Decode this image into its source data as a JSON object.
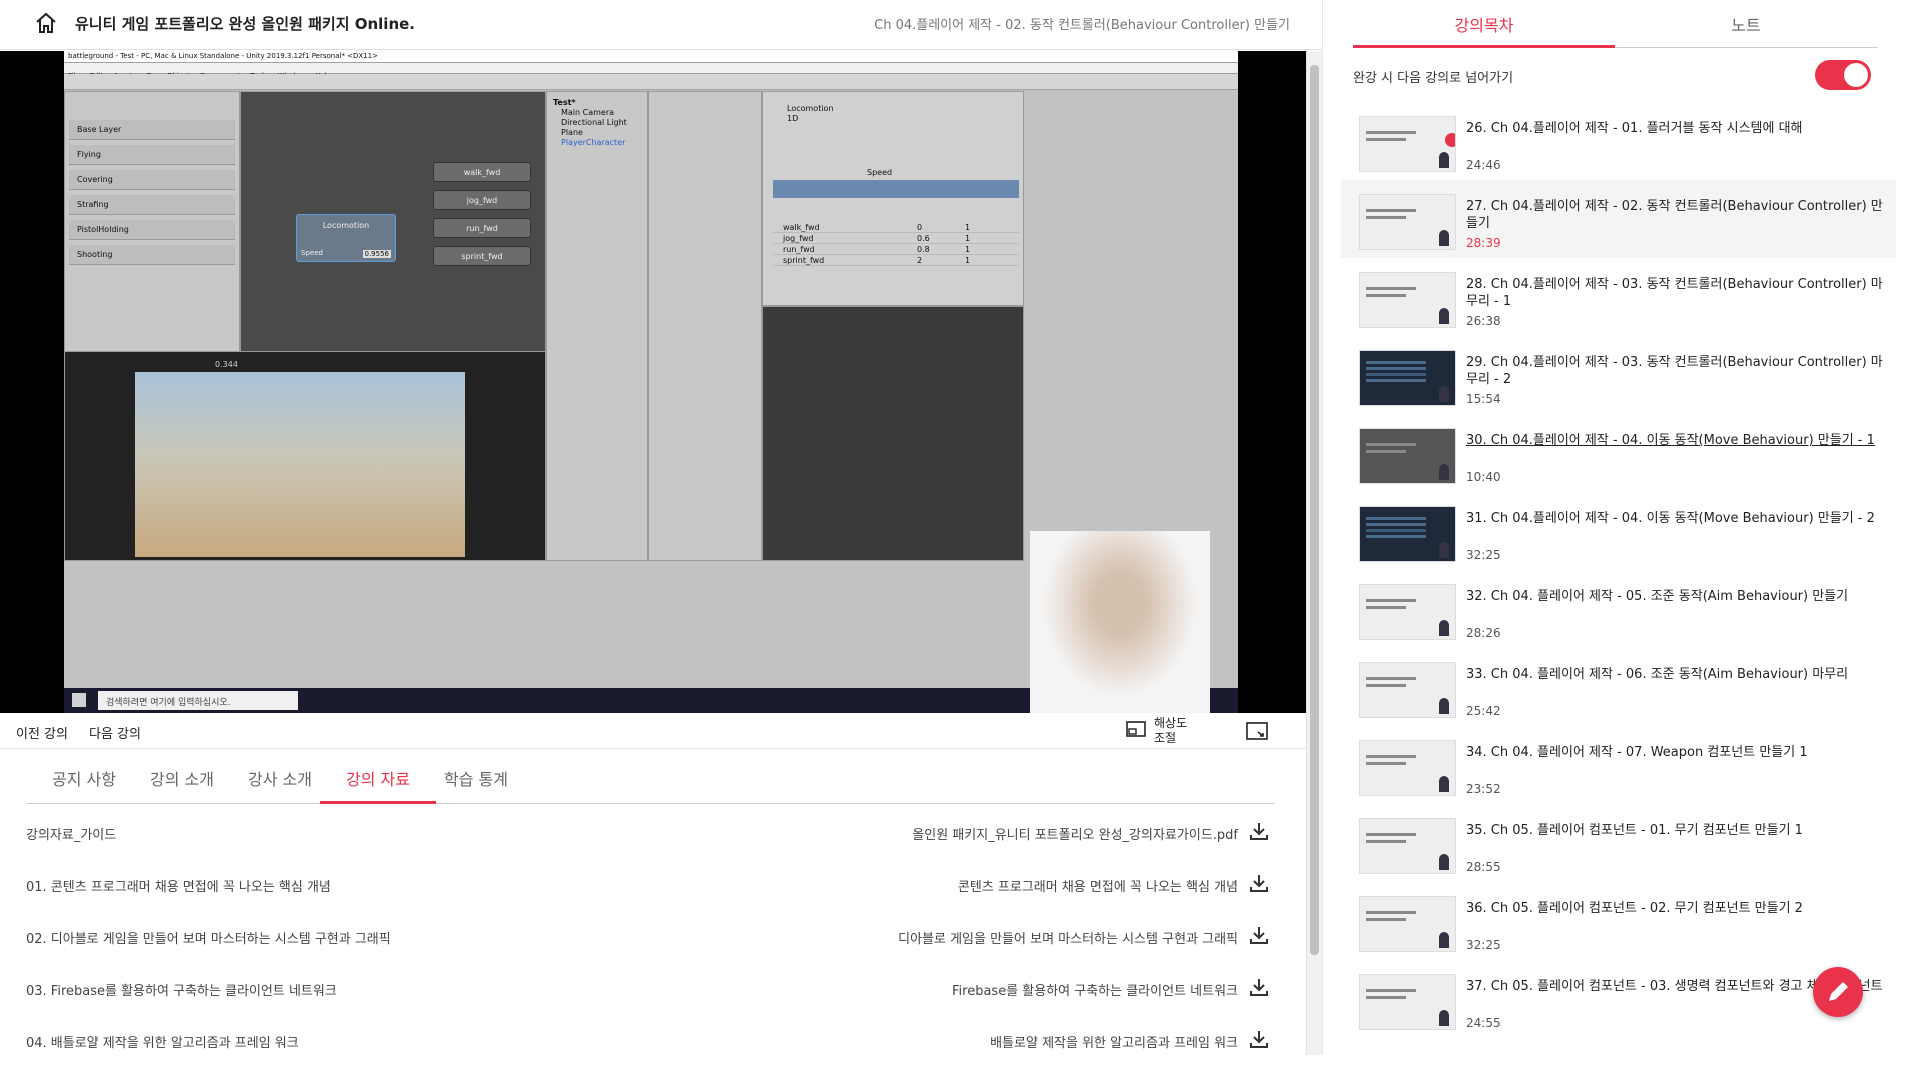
{
  "header": {
    "course_title": "유니티 게임 포트폴리오 완성 올인원 패키지 Online.",
    "lecture_title": "Ch 04.플레이어 제작 - 02. 동작 컨트롤러(Behaviour Controller) 만들기"
  },
  "video": {
    "window_title": "battleground - Test - PC, Mac & Linux Standalone - Unity 2019.3.12f1 Personal* <DX11>",
    "menu": [
      "File",
      "Edit",
      "Assets",
      "GameObject",
      "Component",
      "Tools",
      "Window",
      "Help"
    ],
    "animator_layers": [
      "Base Layer",
      "Flying",
      "Covering",
      "Strafing",
      "PistolHolding",
      "Shooting"
    ],
    "blend_node": "Locomotion",
    "blend_outputs": [
      "walk_fwd",
      "jog_fwd",
      "run_fwd",
      "sprint_fwd"
    ],
    "speed_param": "Speed",
    "speed_value": "0.9556",
    "hierarchy_root": "Test*",
    "hierarchy_items": [
      "Main Camera",
      "Directional Light",
      "Plane",
      "PlayerCharacter"
    ],
    "inspector_title": "Locomotion",
    "blend_type": "1D",
    "parameter": "Speed",
    "motions": [
      {
        "name": "walk_fwd",
        "threshold": "0",
        "speed": "1"
      },
      {
        "name": "jog_fwd",
        "threshold": "0.6",
        "speed": "1"
      },
      {
        "name": "run_fwd",
        "threshold": "0.8",
        "speed": "1"
      },
      {
        "name": "sprint_fwd",
        "threshold": "2",
        "speed": "1"
      }
    ],
    "game_scale": "0.344",
    "taskbar_search": "검색하려면 여기에 입력하십시오."
  },
  "controls": {
    "prev": "이전 강의",
    "next": "다음 강의",
    "resolution": "해상도\n조절"
  },
  "tabs": [
    "공지 사항",
    "강의 소개",
    "강사 소개",
    "강의 자료",
    "학습 통계"
  ],
  "active_tab": "강의 자료",
  "materials": [
    {
      "left": "강의자료_가이드",
      "right": "올인원 패키지_유니티 포트폴리오 완성_강의자료가이드.pdf"
    },
    {
      "left": "01. 콘텐츠 프로그래머 채용 면접에 꼭 나오는 핵심 개념",
      "right": "콘텐츠 프로그래머 채용 면접에 꼭 나오는 핵심 개념"
    },
    {
      "left": "02. 디아블로 게임을 만들어 보며 마스터하는 시스템 구현과 그래픽",
      "right": "디아블로 게임을 만들어 보며 마스터하는 시스템 구현과 그래픽"
    },
    {
      "left": "03. Firebase를 활용하여 구축하는 클라이언트 네트워크",
      "right": "Firebase를 활용하여 구축하는 클라이언트 네트워크"
    },
    {
      "left": "04. 배틀로얄 제작을 위한 알고리즘과 프레임 워크",
      "right": "배틀로얄 제작을 위한 알고리즘과 프레임 워크"
    }
  ],
  "sidebar": {
    "tabs": [
      "강의목차",
      "노트"
    ],
    "autoplay_label": "완강 시 다음 강의로 넘어가기",
    "autoplay_on": true,
    "lectures": [
      {
        "title": "26. Ch 04.플레이어 제작 - 01. 플러거블 동작 시스템에 대해",
        "duration": "24:46",
        "thumb": "light",
        "done": true
      },
      {
        "title": "27. Ch 04.플레이어 제작 - 02. 동작 컨트롤러(Behaviour Controller) 만들기",
        "duration": "28:39",
        "thumb": "light",
        "current": true
      },
      {
        "title": "28. Ch 04.플레이어 제작 - 03. 동작 컨트롤러(Behaviour Controller) 마무리 - 1",
        "duration": "26:38",
        "thumb": "light"
      },
      {
        "title": "29. Ch 04.플레이어 제작 - 03. 동작 컨트롤러(Behaviour Controller) 마무리 - 2",
        "duration": "15:54",
        "thumb": "dark"
      },
      {
        "title": "30. Ch 04.플레이어 제작 - 04. 이동 동작(Move Behaviour) 만들기 - 1",
        "duration": "10:40",
        "thumb": "mid",
        "link": true
      },
      {
        "title": "31. Ch 04.플레이어 제작 - 04. 이동 동작(Move Behaviour) 만들기 - 2",
        "duration": "32:25",
        "thumb": "dark"
      },
      {
        "title": "32. Ch 04. 플레이어 제작 - 05. 조준 동작(Aim Behaviour) 만들기",
        "duration": "28:26",
        "thumb": "light"
      },
      {
        "title": "33. Ch 04. 플레이어 제작 - 06. 조준 동작(Aim Behaviour) 마무리",
        "duration": "25:42",
        "thumb": "light"
      },
      {
        "title": "34. Ch 04. 플레이어 제작 - 07. Weapon 컴포넌트 만들기 1",
        "duration": "23:52",
        "thumb": "light"
      },
      {
        "title": "35. Ch 05. 플레이어 컴포넌트 - 01. 무기 컴포넌트 만들기 1",
        "duration": "28:55",
        "thumb": "light"
      },
      {
        "title": "36. Ch 05. 플레이어 컴포넌트 - 02. 무기 컴포넌트 만들기 2",
        "duration": "32:25",
        "thumb": "light"
      },
      {
        "title": "37. Ch 05. 플레이어 컴포넌트 - 03. 생명력 컴포넌트와 경고 체크 컴포넌트",
        "duration": "24:55",
        "thumb": "light"
      }
    ]
  },
  "colors": {
    "accent": "#e8334a"
  }
}
